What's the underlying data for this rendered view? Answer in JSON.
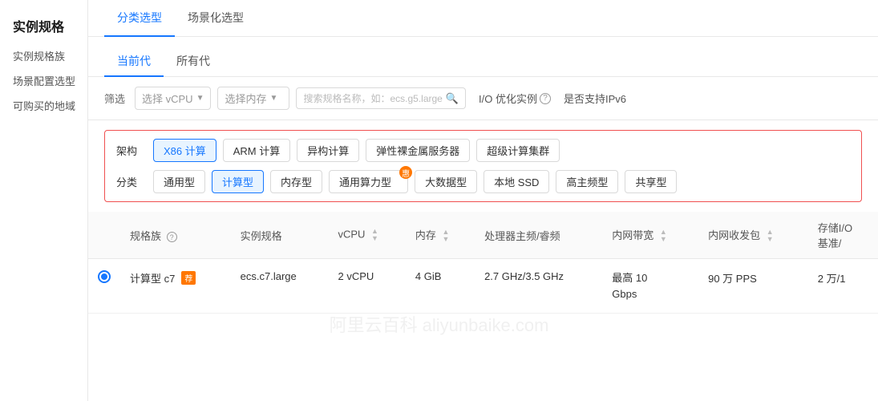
{
  "sidebar": {
    "title": "实例规格",
    "items": [
      {
        "label": "实例规格族"
      },
      {
        "label": "场景配置选型"
      },
      {
        "label": "可购买的地域"
      }
    ]
  },
  "topTabs": [
    {
      "label": "分类选型",
      "active": true
    },
    {
      "label": "场景化选型",
      "active": false
    }
  ],
  "genTabs": [
    {
      "label": "当前代",
      "active": true
    },
    {
      "label": "所有代",
      "active": false
    }
  ],
  "filter": {
    "label": "筛选",
    "vcpuPlaceholder": "选择 vCPU",
    "memPlaceholder": "选择内存",
    "searchPlaceholder": "搜索规格名称，如：ecs.g5.large",
    "ioLabel": "I/O 优化实例",
    "ipv6Label": "是否支持IPv6"
  },
  "archSection": {
    "archLabel": "架构",
    "categoryLabel": "分类",
    "archTags": [
      {
        "label": "X86 计算",
        "active": true
      },
      {
        "label": "ARM 计算",
        "active": false
      },
      {
        "label": "异构计算",
        "active": false
      },
      {
        "label": "弹性裸金属服务器",
        "active": false
      },
      {
        "label": "超级计算集群",
        "active": false
      }
    ],
    "categoryTags": [
      {
        "label": "通用型",
        "active": false,
        "badge": false
      },
      {
        "label": "计算型",
        "active": true,
        "badge": false
      },
      {
        "label": "内存型",
        "active": false,
        "badge": false
      },
      {
        "label": "通用算力型",
        "active": false,
        "badge": true,
        "badgeText": "惠"
      },
      {
        "label": "大数据型",
        "active": false,
        "badge": false
      },
      {
        "label": "本地 SSD",
        "active": false,
        "badge": false
      },
      {
        "label": "高主频型",
        "active": false,
        "badge": false
      },
      {
        "label": "共享型",
        "active": false,
        "badge": false
      }
    ]
  },
  "table": {
    "columns": [
      {
        "label": "",
        "key": "select"
      },
      {
        "label": "规格族",
        "key": "family",
        "helpIcon": true
      },
      {
        "label": "实例规格",
        "key": "spec"
      },
      {
        "label": "vCPU",
        "key": "vcpu",
        "sortable": true
      },
      {
        "label": "内存",
        "key": "memory",
        "sortable": true
      },
      {
        "label": "处理器主频/睿频",
        "key": "frequency"
      },
      {
        "label": "内网带宽",
        "key": "bandwidth",
        "sortable": true
      },
      {
        "label": "内网收发包",
        "key": "packets",
        "sortable": true
      },
      {
        "label": "存储I/O\n基准/",
        "key": "storage"
      }
    ],
    "rows": [
      {
        "selected": true,
        "family": "计算型 c7",
        "familyBadge": "荐",
        "spec": "ecs.c7.large",
        "vcpu": "2 vCPU",
        "memory": "4 GiB",
        "frequency": "2.7 GHz/3.5 GHz",
        "bandwidth": "最高 10\nGbps",
        "packets": "90 万 PPS",
        "storage": "2 万/1"
      }
    ]
  },
  "watermark": "阿里云百科 aliyunbaike.com"
}
